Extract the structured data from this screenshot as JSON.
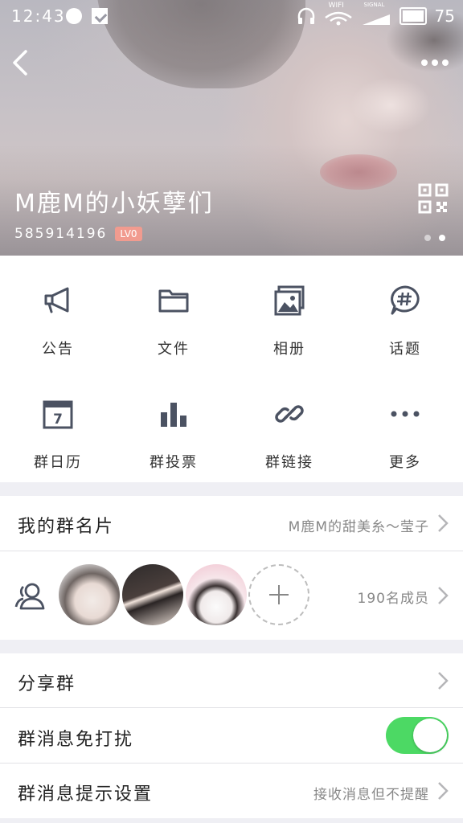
{
  "status_bar": {
    "time": "12:43",
    "wifi_label": "WIFI",
    "signal_label": "SIGNAL",
    "battery": "75"
  },
  "header": {
    "group_name": "M鹿M的小妖孽们",
    "group_id": "585914196",
    "level_badge": "LV0"
  },
  "functions": [
    {
      "label": "公告",
      "icon": "megaphone-icon"
    },
    {
      "label": "文件",
      "icon": "folder-icon"
    },
    {
      "label": "相册",
      "icon": "album-icon"
    },
    {
      "label": "话题",
      "icon": "topic-icon"
    },
    {
      "label": "群日历",
      "icon": "calendar-icon"
    },
    {
      "label": "群投票",
      "icon": "vote-icon"
    },
    {
      "label": "群链接",
      "icon": "link-icon"
    },
    {
      "label": "更多",
      "icon": "more-dots-icon"
    }
  ],
  "calendar_day": "7",
  "card": {
    "label": "我的群名片",
    "value": "M鹿M的甜美糸～莹子"
  },
  "members": {
    "count": "190名成员"
  },
  "share": {
    "label": "分享群"
  },
  "mute": {
    "label": "群消息免打扰",
    "enabled": true
  },
  "notify": {
    "label": "群消息提示设置",
    "value": "接收消息但不提醒"
  },
  "colors": {
    "toggle_on": "#4cd964",
    "icon": "#4b5262",
    "badge": "#f19b8f"
  }
}
